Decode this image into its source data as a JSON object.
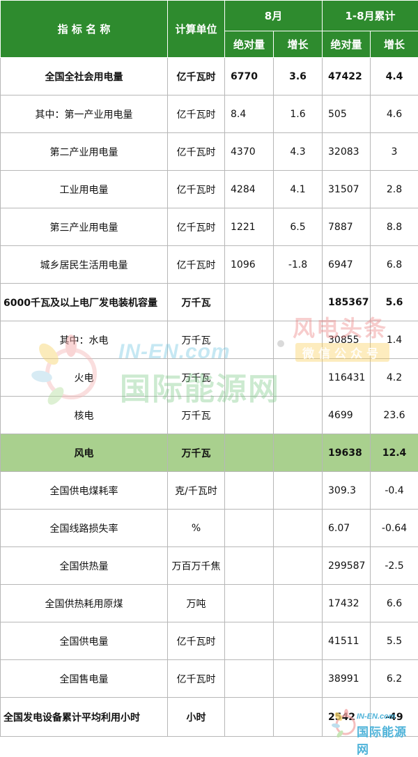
{
  "header": {
    "name_col": "指 标 名 称",
    "unit_col": "计算单位",
    "month_group": "8月",
    "cumulative_group": "1-8月累计",
    "abs_label": "绝对量",
    "growth_label": "增长"
  },
  "rows": [
    {
      "name": "全国全社会用电量",
      "unit": "亿千瓦时",
      "m_abs": "6770",
      "m_growth": "3.6",
      "c_abs": "47422",
      "c_growth": "4.4"
    },
    {
      "name": "其中：第一产业用电量",
      "unit": "亿千瓦时",
      "m_abs": "8.4",
      "m_growth": "1.6",
      "c_abs": "505",
      "c_growth": "4.6"
    },
    {
      "name": "第二产业用电量",
      "unit": "亿千瓦时",
      "m_abs": "4370",
      "m_growth": "4.3",
      "c_abs": "32083",
      "c_growth": "3"
    },
    {
      "name": "工业用电量",
      "unit": "亿千瓦时",
      "m_abs": "4284",
      "m_growth": "4.1",
      "c_abs": "31507",
      "c_growth": "2.8"
    },
    {
      "name": "第三产业用电量",
      "unit": "亿千瓦时",
      "m_abs": "1221",
      "m_growth": "6.5",
      "c_abs": "7887",
      "c_growth": "8.8"
    },
    {
      "name": "城乡居民生活用电量",
      "unit": "亿千瓦时",
      "m_abs": "1096",
      "m_growth": "-1.8",
      "c_abs": "6947",
      "c_growth": "6.8"
    },
    {
      "name": "6000千瓦及以上电厂发电装机容量",
      "unit": "万千瓦",
      "m_abs": "",
      "m_growth": "",
      "c_abs": "185367",
      "c_growth": "5.6"
    },
    {
      "name": "其中：水电",
      "unit": "万千瓦",
      "m_abs": "",
      "m_growth": "",
      "c_abs": "30855",
      "c_growth": "1.4"
    },
    {
      "name": "火电",
      "unit": "万千瓦",
      "m_abs": "",
      "m_growth": "",
      "c_abs": "116431",
      "c_growth": "4.2"
    },
    {
      "name": "核电",
      "unit": "万千瓦",
      "m_abs": "",
      "m_growth": "",
      "c_abs": "4699",
      "c_growth": "23.6"
    },
    {
      "name": "风电",
      "unit": "万千瓦",
      "m_abs": "",
      "m_growth": "",
      "c_abs": "19638",
      "c_growth": "12.4"
    },
    {
      "name": "全国供电煤耗率",
      "unit": "克/千瓦时",
      "m_abs": "",
      "m_growth": "",
      "c_abs": "309.3",
      "c_growth": "-0.4"
    },
    {
      "name": "全国线路损失率",
      "unit": "%",
      "m_abs": "",
      "m_growth": "",
      "c_abs": "6.07",
      "c_growth": "-0.64"
    },
    {
      "name": "全国供热量",
      "unit": "万百万千焦",
      "m_abs": "",
      "m_growth": "",
      "c_abs": "299587",
      "c_growth": "-2.5"
    },
    {
      "name": "全国供热耗用原煤",
      "unit": "万吨",
      "m_abs": "",
      "m_growth": "",
      "c_abs": "17432",
      "c_growth": "6.6"
    },
    {
      "name": "全国供电量",
      "unit": "亿千瓦时",
      "m_abs": "",
      "m_growth": "",
      "c_abs": "41511",
      "c_growth": "5.5"
    },
    {
      "name": "全国售电量",
      "unit": "亿千瓦时",
      "m_abs": "",
      "m_growth": "",
      "c_abs": "38991",
      "c_growth": "6.2"
    },
    {
      "name": "全国发电设备累计平均利用小时",
      "unit": "小时",
      "m_abs": "",
      "m_growth": "",
      "c_abs": "2542",
      "c_growth": "-49"
    }
  ],
  "watermark": {
    "brand_en": "IN-EN.com",
    "brand_cn": "国际能源网",
    "wechat_title": "风电头条",
    "wechat_sub": "微信公众号",
    "footer_brand_en": "IN-EN.com",
    "footer_brand_cn": "国际能源网"
  }
}
